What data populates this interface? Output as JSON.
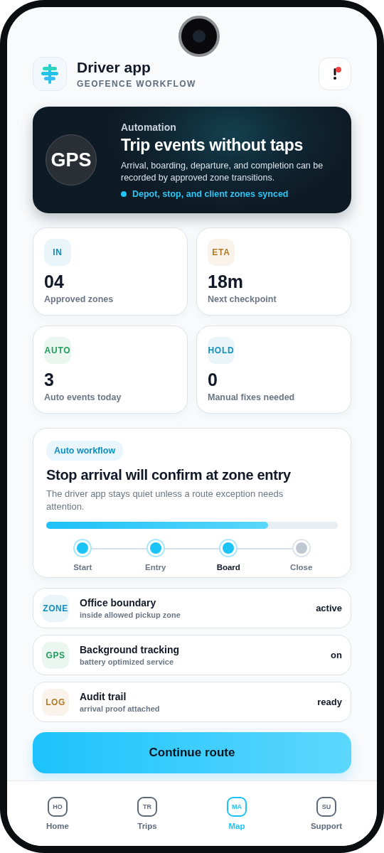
{
  "header": {
    "title": "Driver app",
    "subtitle": "GEOFENCE WORKFLOW",
    "notification": {
      "unread": true
    }
  },
  "hero": {
    "eyebrow": "Automation",
    "badge": "GPS",
    "title": "Trip events without taps",
    "body": "Arrival, boarding, departure, and completion can be recorded by approved zone transitions.",
    "status": "Depot, stop, and client zones synced"
  },
  "stats": [
    {
      "tag": "IN",
      "color": "#0e8fc0",
      "value": "04",
      "label": "Approved zones"
    },
    {
      "tag": "ETA",
      "color": "#b7791f",
      "value": "18m",
      "label": "Next checkpoint"
    },
    {
      "tag": "AUTO",
      "color": "#1f9d5c",
      "value": "3",
      "label": "Auto events today"
    },
    {
      "tag": "HOLD",
      "color": "#0e8fc0",
      "value": "0",
      "label": "Manual fixes needed"
    }
  ],
  "workflow": {
    "chip": "Auto workflow",
    "title": "Stop arrival will confirm at zone entry",
    "body": "The driver app stays quiet unless a route exception needs attention.",
    "level": 0.76,
    "steps": [
      {
        "label": "Start",
        "done": true,
        "selected": false
      },
      {
        "label": "Entry",
        "done": true,
        "selected": false
      },
      {
        "label": "Board",
        "done": true,
        "selected": true
      },
      {
        "label": "Close",
        "done": false,
        "selected": false
      }
    ]
  },
  "rows": [
    {
      "tag": "ZONE",
      "color": "#0e8fc0",
      "title": "Office boundary",
      "subtitle": "inside allowed pickup zone",
      "status": "active"
    },
    {
      "tag": "GPS",
      "color": "#1f9d5c",
      "title": "Background tracking",
      "subtitle": "battery optimized service",
      "status": "on"
    },
    {
      "tag": "LOG",
      "color": "#b7791f",
      "title": "Audit trail",
      "subtitle": "arrival proof attached",
      "status": "ready"
    }
  ],
  "primary_button": "Continue route",
  "nav": [
    {
      "icon": "HO",
      "label": "Home",
      "selected": false
    },
    {
      "icon": "TR",
      "label": "Trips",
      "selected": false
    },
    {
      "icon": "MA",
      "label": "Map",
      "selected": true
    },
    {
      "icon": "SU",
      "label": "Support",
      "selected": false
    }
  ]
}
